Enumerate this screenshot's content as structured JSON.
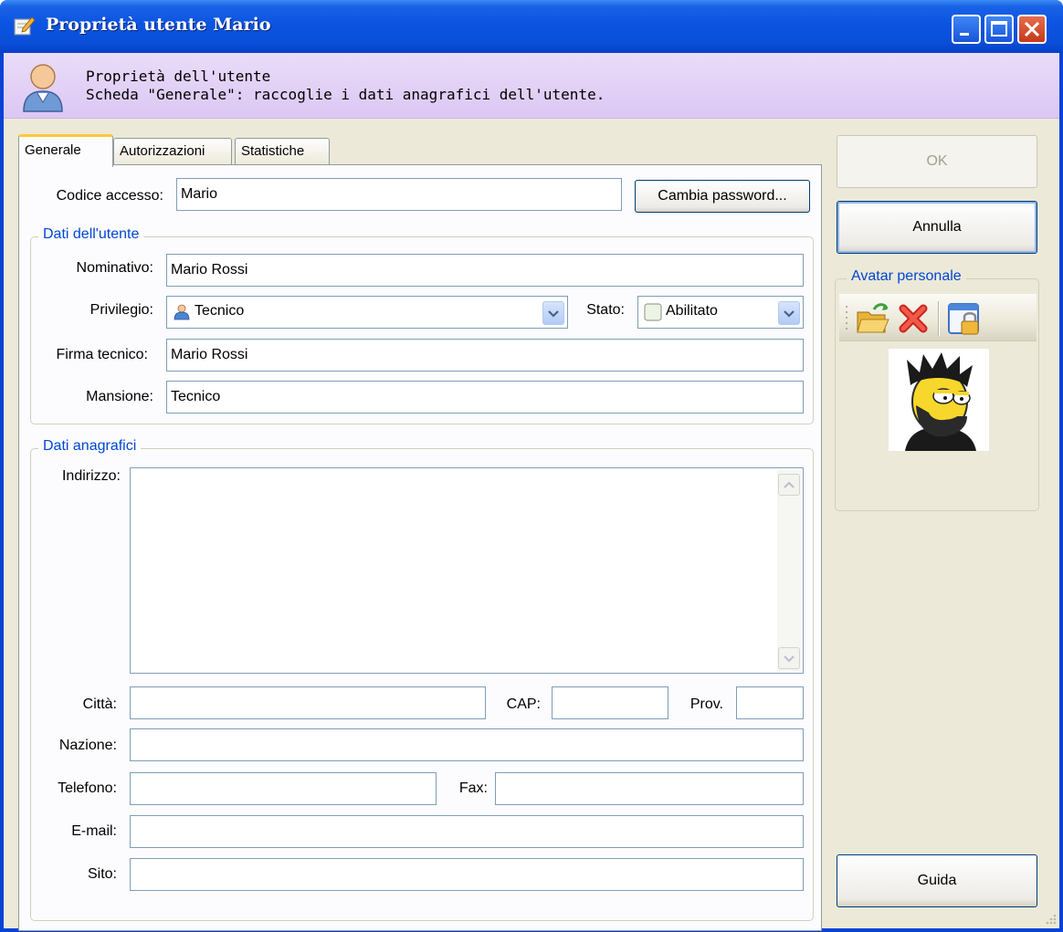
{
  "window": {
    "title": "Proprietà utente Mario"
  },
  "header": {
    "line1": "Proprietà dell'utente",
    "line2": "Scheda \"Generale\": raccoglie i dati anagrafici dell'utente."
  },
  "tabs": [
    {
      "label": "Generale",
      "active": true
    },
    {
      "label": "Autorizzazioni",
      "active": false
    },
    {
      "label": "Statistiche",
      "active": false
    }
  ],
  "general": {
    "codice_label": "Codice accesso:",
    "codice_value": "Mario",
    "cambia_password_label": "Cambia password...",
    "dati_utente_title": "Dati dell'utente",
    "nominativo_label": "Nominativo:",
    "nominativo_value": "Mario Rossi",
    "privilegio_label": "Privilegio:",
    "privilegio_value": "Tecnico",
    "stato_label": "Stato:",
    "stato_value": "Abilitato",
    "firma_label": "Firma tecnico:",
    "firma_value": "Mario Rossi",
    "mansione_label": "Mansione:",
    "mansione_value": "Tecnico",
    "dati_anagrafici_title": "Dati anagrafici",
    "indirizzo_label": "Indirizzo:",
    "indirizzo_value": "",
    "citta_label": "Città:",
    "citta_value": "",
    "cap_label": "CAP:",
    "cap_value": "",
    "prov_label": "Prov.",
    "prov_value": "",
    "nazione_label": "Nazione:",
    "nazione_value": "",
    "telefono_label": "Telefono:",
    "telefono_value": "",
    "fax_label": "Fax:",
    "fax_value": "",
    "email_label": "E-mail:",
    "email_value": "",
    "sito_label": "Sito:",
    "sito_value": ""
  },
  "buttons": {
    "ok": "OK",
    "annulla": "Annulla",
    "guida": "Guida"
  },
  "avatar": {
    "group_title": "Avatar personale",
    "tools": [
      "open-folder-icon",
      "delete-icon",
      "window-lock-icon"
    ]
  },
  "colors": {
    "titlebar": "#0b54e2",
    "header_bg": "#e3d3f7",
    "dialog_bg": "#ece9d8",
    "group_title": "#0046d5",
    "field_border": "#7f9db9"
  }
}
